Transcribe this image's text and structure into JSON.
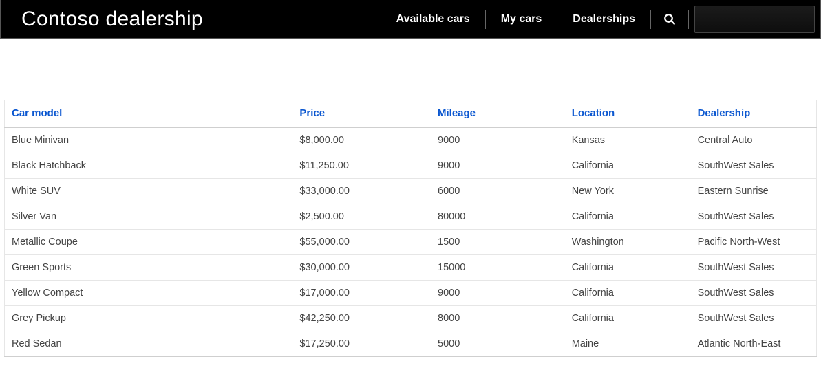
{
  "header": {
    "brand": "Contoso dealership",
    "nav": {
      "available": "Available cars",
      "mycars": "My cars",
      "dealerships": "Dealerships"
    }
  },
  "table": {
    "columns": {
      "model": "Car model",
      "price": "Price",
      "mileage": "Mileage",
      "location": "Location",
      "dealership": "Dealership"
    },
    "rows": [
      {
        "model": "Blue Minivan",
        "price": "$8,000.00",
        "mileage": "9000",
        "location": "Kansas",
        "dealership": "Central Auto"
      },
      {
        "model": "Black Hatchback",
        "price": "$11,250.00",
        "mileage": "9000",
        "location": "California",
        "dealership": "SouthWest Sales"
      },
      {
        "model": "White SUV",
        "price": "$33,000.00",
        "mileage": "6000",
        "location": "New York",
        "dealership": "Eastern Sunrise"
      },
      {
        "model": "Silver Van",
        "price": "$2,500.00",
        "mileage": "80000",
        "location": "California",
        "dealership": "SouthWest Sales"
      },
      {
        "model": "Metallic Coupe",
        "price": "$55,000.00",
        "mileage": "1500",
        "location": "Washington",
        "dealership": "Pacific North-West"
      },
      {
        "model": "Green Sports",
        "price": "$30,000.00",
        "mileage": "15000",
        "location": "California",
        "dealership": "SouthWest Sales"
      },
      {
        "model": "Yellow Compact",
        "price": "$17,000.00",
        "mileage": "9000",
        "location": "California",
        "dealership": "SouthWest Sales"
      },
      {
        "model": "Grey Pickup",
        "price": "$42,250.00",
        "mileage": "8000",
        "location": "California",
        "dealership": "SouthWest Sales"
      },
      {
        "model": "Red Sedan",
        "price": "$17,250.00",
        "mileage": "5000",
        "location": "Maine",
        "dealership": "Atlantic North-East"
      }
    ]
  }
}
